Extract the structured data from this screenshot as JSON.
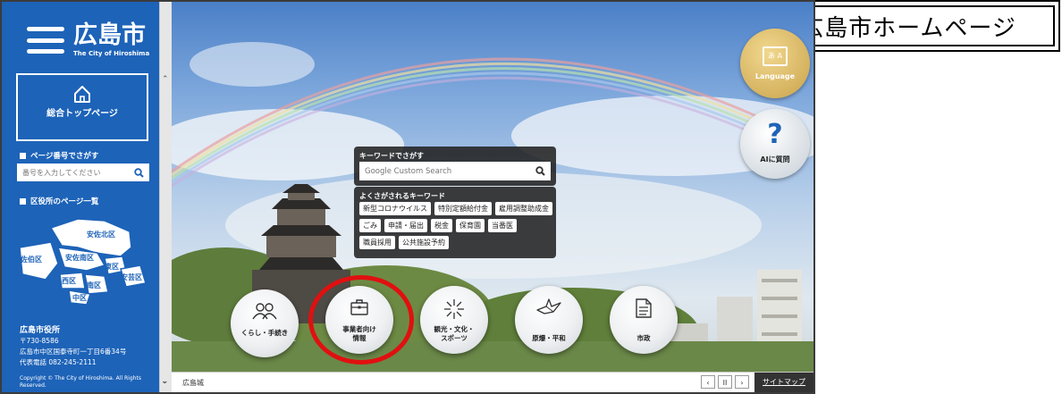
{
  "callout": {
    "label": "広島市ホームページ"
  },
  "sidebar": {
    "logo_name": "広島市",
    "logo_sub": "The City of Hiroshima",
    "top_button_label": "総合トップページ",
    "page_search_label": "ページ番号でさがす",
    "page_search_placeholder": "番号を入力してください",
    "ward_list_label": "区役所のページ一覧",
    "wards": [
      "安佐北区",
      "佐伯区",
      "安佐南区",
      "東区",
      "西区",
      "安芸区",
      "南区",
      "中区"
    ],
    "office_name": "広島市役所",
    "postal": "〒730-8586",
    "address": "広島市中区国泰寺町一丁目6番34号",
    "phone": "代表電話 082-245-2111",
    "copyright": "Copyright © The City of Hiroshima. All Rights Reserved."
  },
  "right_buttons": {
    "language_label": "Language",
    "ai_label": "AIに質問"
  },
  "search": {
    "label": "キーワードでさがす",
    "placeholder": "Google Custom Search"
  },
  "keywords": {
    "label": "よくさがされるキーワード",
    "items": [
      "新型コロナウイルス",
      "特別定額給付金",
      "雇用調整助成金",
      "ごみ",
      "申請・届出",
      "税金",
      "保育園",
      "当番医",
      "職員採用",
      "公共施設予約"
    ]
  },
  "categories": [
    {
      "label": "くらし・手続き",
      "icon": "people-icon"
    },
    {
      "label": "事業者向け情報",
      "icon": "briefcase-icon"
    },
    {
      "label": "観光・文化・スポーツ",
      "icon": "fireworks-icon"
    },
    {
      "label": "原爆・平和",
      "icon": "crane-icon"
    },
    {
      "label": "市政",
      "icon": "document-icon"
    }
  ],
  "bottom_bar": {
    "caption": "広島城",
    "prev": "‹",
    "pause": "II",
    "next": "›",
    "sitemap_label": "サイトマップ"
  },
  "colors": {
    "sidebar_blue": "#1d63b8",
    "highlight_red": "#e01010",
    "panel_dark": "#222222"
  }
}
